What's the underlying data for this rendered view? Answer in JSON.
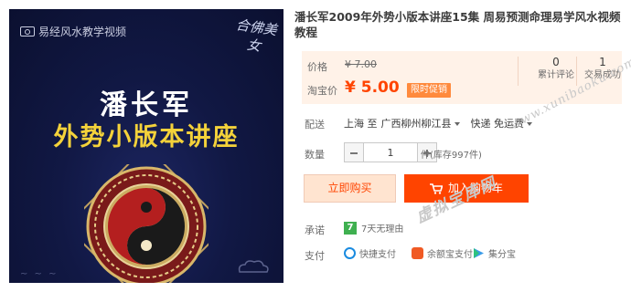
{
  "image": {
    "watermark": "易经风水教学视频",
    "seal_text": "合佛美女",
    "line1": "潘长军",
    "line2": "外势小版本讲座"
  },
  "title": "潘长军2009年外势小版本讲座15集 周易预测命理易学风水视频教程",
  "price": {
    "label": "价格",
    "original": "¥ 7.00",
    "promo_label": "淘宝价",
    "promo": "¥ 5.00",
    "badge": "限时促销"
  },
  "stats": {
    "reviews_count": "0",
    "reviews_label": "累计评论",
    "deals_count": "1",
    "deals_label": "交易成功"
  },
  "delivery": {
    "label": "配送",
    "from": "上海 至",
    "to": "广西柳州柳江县",
    "method": "快递 免运费"
  },
  "quantity": {
    "label": "数量",
    "value": "1",
    "stock": "件(库存997件)"
  },
  "actions": {
    "buy": "立即购买",
    "cart": "加入购物车"
  },
  "pledge": {
    "label": "承诺",
    "icon_text": "7",
    "text": "7天无理由"
  },
  "payment": {
    "label": "支付",
    "methods": [
      "快捷支付",
      "余额宝支付",
      "集分宝"
    ]
  },
  "watermarks": {
    "url": "www.xunibaoku.com",
    "name": "虚拟宝库网"
  },
  "colors": {
    "accent": "#ff4400",
    "price_bg": "#fff2e8",
    "buy_bg": "#ffe4d0"
  }
}
